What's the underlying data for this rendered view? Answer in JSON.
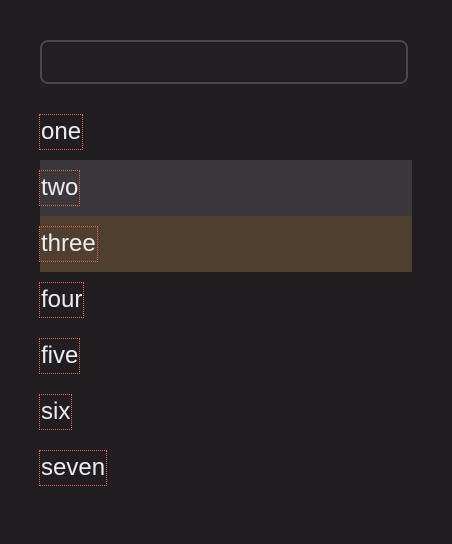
{
  "search": {
    "placeholder": "",
    "value": ""
  },
  "list": {
    "items": [
      {
        "label": "one",
        "state": "normal"
      },
      {
        "label": "two",
        "state": "hovered"
      },
      {
        "label": "three",
        "state": "selected"
      },
      {
        "label": "four",
        "state": "normal"
      },
      {
        "label": "five",
        "state": "normal"
      },
      {
        "label": "six",
        "state": "normal"
      },
      {
        "label": "seven",
        "state": "normal"
      }
    ]
  },
  "colors": {
    "background": "#211e22",
    "hover": "#3a373d",
    "selected": "#4e3f2f",
    "label_outline": "#ff6347"
  }
}
